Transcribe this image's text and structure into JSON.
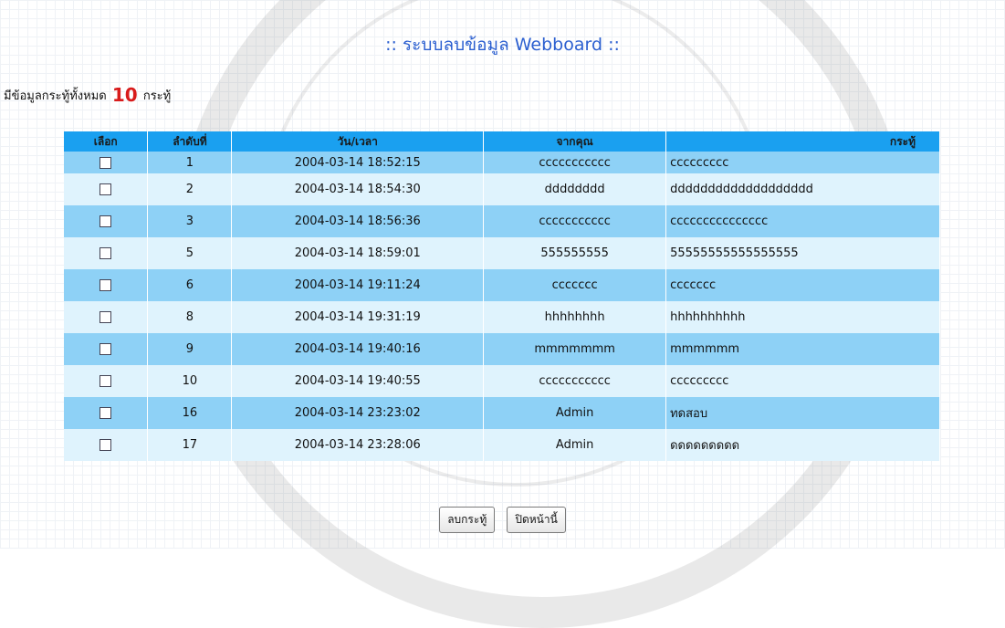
{
  "page": {
    "title": ":: ระบบลบข้อมูล Webboard ::",
    "count_prefix": "มีข้อมูลกระทู้ทั้งหมด",
    "count_value": "10",
    "count_suffix": "กระทู้"
  },
  "table": {
    "headers": [
      "เลือก",
      "ลำดับที่",
      "วัน/เวลา",
      "จากคุณ",
      "กระทู้"
    ],
    "rows": [
      {
        "no": "1",
        "datetime": "2004-03-14 18:52:15",
        "from": "ccccccccccc",
        "msg": "ccccccccc"
      },
      {
        "no": "2",
        "datetime": "2004-03-14 18:54:30",
        "from": "dddddddd",
        "msg": "ddddddddddddddddddd"
      },
      {
        "no": "3",
        "datetime": "2004-03-14 18:56:36",
        "from": "ccccccccccc",
        "msg": "ccccccccccccccc"
      },
      {
        "no": "5",
        "datetime": "2004-03-14 18:59:01",
        "from": "555555555",
        "msg": "55555555555555555"
      },
      {
        "no": "6",
        "datetime": "2004-03-14 19:11:24",
        "from": "ccccccc",
        "msg": "ccccccc"
      },
      {
        "no": "8",
        "datetime": "2004-03-14 19:31:19",
        "from": "hhhhhhhh",
        "msg": "hhhhhhhhhh"
      },
      {
        "no": "9",
        "datetime": "2004-03-14 19:40:16",
        "from": "mmmmmmm",
        "msg": "mmmmmm"
      },
      {
        "no": "10",
        "datetime": "2004-03-14 19:40:55",
        "from": "ccccccccccc",
        "msg": "ccccccccc"
      },
      {
        "no": "16",
        "datetime": "2004-03-14 23:23:02",
        "from": "Admin",
        "msg": "ทดสอบ"
      },
      {
        "no": "17",
        "datetime": "2004-03-14 23:28:06",
        "from": "Admin",
        "msg": "ดดดดดดดดด"
      }
    ]
  },
  "buttons": {
    "delete": "ลบกระทู้",
    "close": "ปิดหน้านี้"
  },
  "colors": {
    "title": "#2b5fd0",
    "count_value": "#d81b1b",
    "header_bg": "#1aa0f0",
    "row_odd": "#8ed1f6",
    "row_even": "#dff3fd"
  }
}
